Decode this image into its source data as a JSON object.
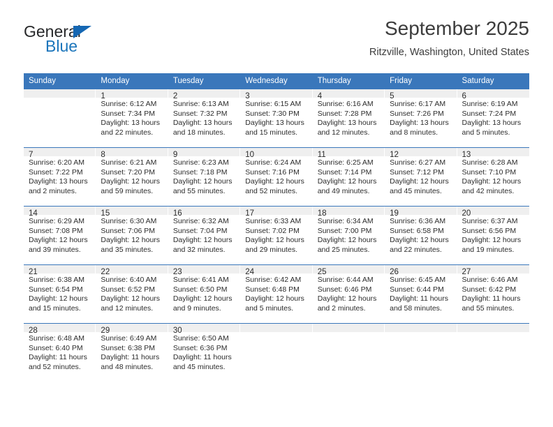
{
  "brand": {
    "name_top": "General",
    "name_bottom": "Blue",
    "accent_color": "#1b75bb",
    "triangle_color": "#1567b3"
  },
  "header": {
    "title": "September 2025",
    "subtitle": "Ritzville, Washington, United States"
  },
  "theme": {
    "header_row_bg": "#3a77bb",
    "daynum_bg": "#efefef",
    "row_divider": "#3a77bb",
    "text": "#2c2c2c"
  },
  "weekdays": [
    "Sunday",
    "Monday",
    "Tuesday",
    "Wednesday",
    "Thursday",
    "Friday",
    "Saturday"
  ],
  "weeks": [
    [
      {
        "day": "",
        "sunrise": "",
        "sunset": "",
        "daylight_line1": "",
        "daylight_line2": ""
      },
      {
        "day": "1",
        "sunrise": "Sunrise: 6:12 AM",
        "sunset": "Sunset: 7:34 PM",
        "daylight_line1": "Daylight: 13 hours",
        "daylight_line2": "and 22 minutes."
      },
      {
        "day": "2",
        "sunrise": "Sunrise: 6:13 AM",
        "sunset": "Sunset: 7:32 PM",
        "daylight_line1": "Daylight: 13 hours",
        "daylight_line2": "and 18 minutes."
      },
      {
        "day": "3",
        "sunrise": "Sunrise: 6:15 AM",
        "sunset": "Sunset: 7:30 PM",
        "daylight_line1": "Daylight: 13 hours",
        "daylight_line2": "and 15 minutes."
      },
      {
        "day": "4",
        "sunrise": "Sunrise: 6:16 AM",
        "sunset": "Sunset: 7:28 PM",
        "daylight_line1": "Daylight: 13 hours",
        "daylight_line2": "and 12 minutes."
      },
      {
        "day": "5",
        "sunrise": "Sunrise: 6:17 AM",
        "sunset": "Sunset: 7:26 PM",
        "daylight_line1": "Daylight: 13 hours",
        "daylight_line2": "and 8 minutes."
      },
      {
        "day": "6",
        "sunrise": "Sunrise: 6:19 AM",
        "sunset": "Sunset: 7:24 PM",
        "daylight_line1": "Daylight: 13 hours",
        "daylight_line2": "and 5 minutes."
      }
    ],
    [
      {
        "day": "7",
        "sunrise": "Sunrise: 6:20 AM",
        "sunset": "Sunset: 7:22 PM",
        "daylight_line1": "Daylight: 13 hours",
        "daylight_line2": "and 2 minutes."
      },
      {
        "day": "8",
        "sunrise": "Sunrise: 6:21 AM",
        "sunset": "Sunset: 7:20 PM",
        "daylight_line1": "Daylight: 12 hours",
        "daylight_line2": "and 59 minutes."
      },
      {
        "day": "9",
        "sunrise": "Sunrise: 6:23 AM",
        "sunset": "Sunset: 7:18 PM",
        "daylight_line1": "Daylight: 12 hours",
        "daylight_line2": "and 55 minutes."
      },
      {
        "day": "10",
        "sunrise": "Sunrise: 6:24 AM",
        "sunset": "Sunset: 7:16 PM",
        "daylight_line1": "Daylight: 12 hours",
        "daylight_line2": "and 52 minutes."
      },
      {
        "day": "11",
        "sunrise": "Sunrise: 6:25 AM",
        "sunset": "Sunset: 7:14 PM",
        "daylight_line1": "Daylight: 12 hours",
        "daylight_line2": "and 49 minutes."
      },
      {
        "day": "12",
        "sunrise": "Sunrise: 6:27 AM",
        "sunset": "Sunset: 7:12 PM",
        "daylight_line1": "Daylight: 12 hours",
        "daylight_line2": "and 45 minutes."
      },
      {
        "day": "13",
        "sunrise": "Sunrise: 6:28 AM",
        "sunset": "Sunset: 7:10 PM",
        "daylight_line1": "Daylight: 12 hours",
        "daylight_line2": "and 42 minutes."
      }
    ],
    [
      {
        "day": "14",
        "sunrise": "Sunrise: 6:29 AM",
        "sunset": "Sunset: 7:08 PM",
        "daylight_line1": "Daylight: 12 hours",
        "daylight_line2": "and 39 minutes."
      },
      {
        "day": "15",
        "sunrise": "Sunrise: 6:30 AM",
        "sunset": "Sunset: 7:06 PM",
        "daylight_line1": "Daylight: 12 hours",
        "daylight_line2": "and 35 minutes."
      },
      {
        "day": "16",
        "sunrise": "Sunrise: 6:32 AM",
        "sunset": "Sunset: 7:04 PM",
        "daylight_line1": "Daylight: 12 hours",
        "daylight_line2": "and 32 minutes."
      },
      {
        "day": "17",
        "sunrise": "Sunrise: 6:33 AM",
        "sunset": "Sunset: 7:02 PM",
        "daylight_line1": "Daylight: 12 hours",
        "daylight_line2": "and 29 minutes."
      },
      {
        "day": "18",
        "sunrise": "Sunrise: 6:34 AM",
        "sunset": "Sunset: 7:00 PM",
        "daylight_line1": "Daylight: 12 hours",
        "daylight_line2": "and 25 minutes."
      },
      {
        "day": "19",
        "sunrise": "Sunrise: 6:36 AM",
        "sunset": "Sunset: 6:58 PM",
        "daylight_line1": "Daylight: 12 hours",
        "daylight_line2": "and 22 minutes."
      },
      {
        "day": "20",
        "sunrise": "Sunrise: 6:37 AM",
        "sunset": "Sunset: 6:56 PM",
        "daylight_line1": "Daylight: 12 hours",
        "daylight_line2": "and 19 minutes."
      }
    ],
    [
      {
        "day": "21",
        "sunrise": "Sunrise: 6:38 AM",
        "sunset": "Sunset: 6:54 PM",
        "daylight_line1": "Daylight: 12 hours",
        "daylight_line2": "and 15 minutes."
      },
      {
        "day": "22",
        "sunrise": "Sunrise: 6:40 AM",
        "sunset": "Sunset: 6:52 PM",
        "daylight_line1": "Daylight: 12 hours",
        "daylight_line2": "and 12 minutes."
      },
      {
        "day": "23",
        "sunrise": "Sunrise: 6:41 AM",
        "sunset": "Sunset: 6:50 PM",
        "daylight_line1": "Daylight: 12 hours",
        "daylight_line2": "and 9 minutes."
      },
      {
        "day": "24",
        "sunrise": "Sunrise: 6:42 AM",
        "sunset": "Sunset: 6:48 PM",
        "daylight_line1": "Daylight: 12 hours",
        "daylight_line2": "and 5 minutes."
      },
      {
        "day": "25",
        "sunrise": "Sunrise: 6:44 AM",
        "sunset": "Sunset: 6:46 PM",
        "daylight_line1": "Daylight: 12 hours",
        "daylight_line2": "and 2 minutes."
      },
      {
        "day": "26",
        "sunrise": "Sunrise: 6:45 AM",
        "sunset": "Sunset: 6:44 PM",
        "daylight_line1": "Daylight: 11 hours",
        "daylight_line2": "and 58 minutes."
      },
      {
        "day": "27",
        "sunrise": "Sunrise: 6:46 AM",
        "sunset": "Sunset: 6:42 PM",
        "daylight_line1": "Daylight: 11 hours",
        "daylight_line2": "and 55 minutes."
      }
    ],
    [
      {
        "day": "28",
        "sunrise": "Sunrise: 6:48 AM",
        "sunset": "Sunset: 6:40 PM",
        "daylight_line1": "Daylight: 11 hours",
        "daylight_line2": "and 52 minutes."
      },
      {
        "day": "29",
        "sunrise": "Sunrise: 6:49 AM",
        "sunset": "Sunset: 6:38 PM",
        "daylight_line1": "Daylight: 11 hours",
        "daylight_line2": "and 48 minutes."
      },
      {
        "day": "30",
        "sunrise": "Sunrise: 6:50 AM",
        "sunset": "Sunset: 6:36 PM",
        "daylight_line1": "Daylight: 11 hours",
        "daylight_line2": "and 45 minutes."
      },
      {
        "day": "",
        "sunrise": "",
        "sunset": "",
        "daylight_line1": "",
        "daylight_line2": ""
      },
      {
        "day": "",
        "sunrise": "",
        "sunset": "",
        "daylight_line1": "",
        "daylight_line2": ""
      },
      {
        "day": "",
        "sunrise": "",
        "sunset": "",
        "daylight_line1": "",
        "daylight_line2": ""
      },
      {
        "day": "",
        "sunrise": "",
        "sunset": "",
        "daylight_line1": "",
        "daylight_line2": ""
      }
    ]
  ]
}
